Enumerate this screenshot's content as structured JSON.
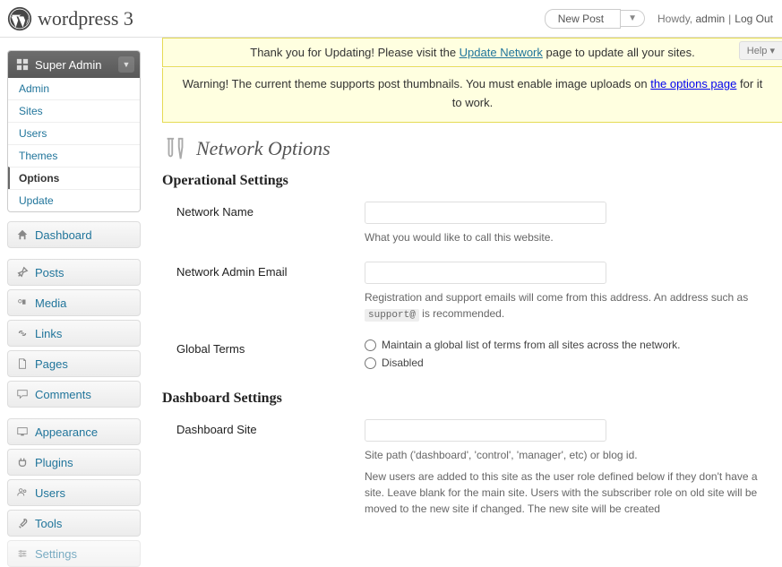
{
  "topbar": {
    "site_title": "wordpress 3",
    "new_post": "New Post",
    "howdy_text": "Howdy, ",
    "user": "admin",
    "logout": "Log Out"
  },
  "help_tab": "Help ▾",
  "sidebar": {
    "super_admin": {
      "label": "Super Admin"
    },
    "super_admin_items": [
      {
        "label": "Admin"
      },
      {
        "label": "Sites"
      },
      {
        "label": "Users"
      },
      {
        "label": "Themes"
      },
      {
        "label": "Options",
        "current": true
      },
      {
        "label": "Update"
      }
    ],
    "dashboard": "Dashboard",
    "posts": "Posts",
    "media": "Media",
    "links": "Links",
    "pages": "Pages",
    "comments": "Comments",
    "appearance": "Appearance",
    "plugins": "Plugins",
    "users": "Users",
    "tools": "Tools",
    "settings": "Settings"
  },
  "notices": {
    "n1_pre": "Thank you for Updating! Please visit the ",
    "n1_link": "Update Network",
    "n1_post": " page to update all your sites.",
    "n2_pre": "Warning! The current theme supports post thumbnails. You must enable image uploads on ",
    "n2_link": "the options page",
    "n2_post": " for it to work."
  },
  "page_title": "Network Options",
  "sections": {
    "operational": "Operational Settings",
    "dashboard": "Dashboard Settings"
  },
  "fields": {
    "network_name": {
      "label": "Network Name",
      "desc": "What you would like to call this website."
    },
    "network_admin_email": {
      "label": "Network Admin Email",
      "desc_pre": "Registration and support emails will come from this address. An address such as ",
      "desc_code": "support@",
      "desc_post": " is recommended."
    },
    "global_terms": {
      "label": "Global Terms",
      "opt1": "Maintain a global list of terms from all sites across the network.",
      "opt2": "Disabled"
    },
    "dashboard_site": {
      "label": "Dashboard Site",
      "desc1": "Site path ('dashboard', 'control', 'manager', etc) or blog id.",
      "desc2": "New users are added to this site as the user role defined below if they don't have a site. Leave blank for the main site. Users with the subscriber role on old site will be moved to the new site if changed. The new site will be created"
    }
  }
}
